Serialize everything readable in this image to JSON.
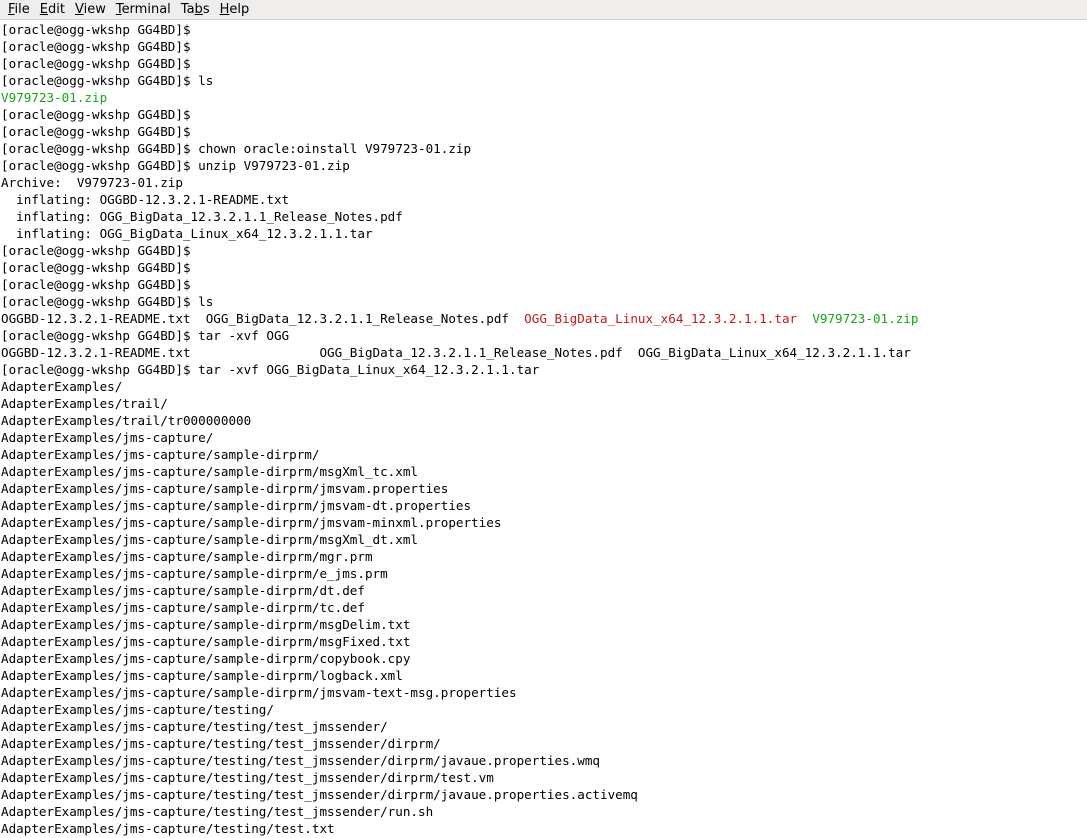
{
  "menubar": {
    "items": [
      {
        "name": "menu-file",
        "pre": "",
        "key": "F",
        "post": "ile"
      },
      {
        "name": "menu-edit",
        "pre": "",
        "key": "E",
        "post": "dit"
      },
      {
        "name": "menu-view",
        "pre": "",
        "key": "V",
        "post": "iew"
      },
      {
        "name": "menu-terminal",
        "pre": "",
        "key": "T",
        "post": "erminal"
      },
      {
        "name": "menu-tabs",
        "pre": "Ta",
        "key": "b",
        "post": "s"
      },
      {
        "name": "menu-help",
        "pre": "",
        "key": "H",
        "post": "elp"
      }
    ]
  },
  "colors": {
    "archive": "#15a515",
    "tarball": "#c01a1a",
    "text": "#000000",
    "background": "#ffffff"
  },
  "terminal": {
    "lines": [
      [
        {
          "t": "[oracle@ogg-wkshp GG4BD]$ "
        }
      ],
      [
        {
          "t": "[oracle@ogg-wkshp GG4BD]$ "
        }
      ],
      [
        {
          "t": "[oracle@ogg-wkshp GG4BD]$ "
        }
      ],
      [
        {
          "t": "[oracle@ogg-wkshp GG4BD]$ ls"
        }
      ],
      [
        {
          "t": "V979723-01.zip",
          "c": "green"
        }
      ],
      [
        {
          "t": "[oracle@ogg-wkshp GG4BD]$ "
        }
      ],
      [
        {
          "t": "[oracle@ogg-wkshp GG4BD]$ "
        }
      ],
      [
        {
          "t": "[oracle@ogg-wkshp GG4BD]$ chown oracle:oinstall V979723-01.zip"
        }
      ],
      [
        {
          "t": "[oracle@ogg-wkshp GG4BD]$ unzip V979723-01.zip"
        }
      ],
      [
        {
          "t": "Archive:  V979723-01.zip"
        }
      ],
      [
        {
          "t": "  inflating: OGGBD-12.3.2.1-README.txt"
        }
      ],
      [
        {
          "t": "  inflating: OGG_BigData_12.3.2.1.1_Release_Notes.pdf"
        }
      ],
      [
        {
          "t": "  inflating: OGG_BigData_Linux_x64_12.3.2.1.1.tar"
        }
      ],
      [
        {
          "t": "[oracle@ogg-wkshp GG4BD]$ "
        }
      ],
      [
        {
          "t": "[oracle@ogg-wkshp GG4BD]$ "
        }
      ],
      [
        {
          "t": "[oracle@ogg-wkshp GG4BD]$ "
        }
      ],
      [
        {
          "t": "[oracle@ogg-wkshp GG4BD]$ ls"
        }
      ],
      [
        {
          "t": "OGGBD-12.3.2.1-README.txt  OGG_BigData_12.3.2.1.1_Release_Notes.pdf  "
        },
        {
          "t": "OGG_BigData_Linux_x64_12.3.2.1.1.tar",
          "c": "red"
        },
        {
          "t": "  "
        },
        {
          "t": "V979723-01.zip",
          "c": "green"
        }
      ],
      [
        {
          "t": "[oracle@ogg-wkshp GG4BD]$ tar -xvf OGG"
        }
      ],
      [
        {
          "t": "OGGBD-12.3.2.1-README.txt                 OGG_BigData_12.3.2.1.1_Release_Notes.pdf  OGG_BigData_Linux_x64_12.3.2.1.1.tar"
        }
      ],
      [
        {
          "t": "[oracle@ogg-wkshp GG4BD]$ tar -xvf OGG_BigData_Linux_x64_12.3.2.1.1.tar"
        }
      ],
      [
        {
          "t": "AdapterExamples/"
        }
      ],
      [
        {
          "t": "AdapterExamples/trail/"
        }
      ],
      [
        {
          "t": "AdapterExamples/trail/tr000000000"
        }
      ],
      [
        {
          "t": "AdapterExamples/jms-capture/"
        }
      ],
      [
        {
          "t": "AdapterExamples/jms-capture/sample-dirprm/"
        }
      ],
      [
        {
          "t": "AdapterExamples/jms-capture/sample-dirprm/msgXml_tc.xml"
        }
      ],
      [
        {
          "t": "AdapterExamples/jms-capture/sample-dirprm/jmsvam.properties"
        }
      ],
      [
        {
          "t": "AdapterExamples/jms-capture/sample-dirprm/jmsvam-dt.properties"
        }
      ],
      [
        {
          "t": "AdapterExamples/jms-capture/sample-dirprm/jmsvam-minxml.properties"
        }
      ],
      [
        {
          "t": "AdapterExamples/jms-capture/sample-dirprm/msgXml_dt.xml"
        }
      ],
      [
        {
          "t": "AdapterExamples/jms-capture/sample-dirprm/mgr.prm"
        }
      ],
      [
        {
          "t": "AdapterExamples/jms-capture/sample-dirprm/e_jms.prm"
        }
      ],
      [
        {
          "t": "AdapterExamples/jms-capture/sample-dirprm/dt.def"
        }
      ],
      [
        {
          "t": "AdapterExamples/jms-capture/sample-dirprm/tc.def"
        }
      ],
      [
        {
          "t": "AdapterExamples/jms-capture/sample-dirprm/msgDelim.txt"
        }
      ],
      [
        {
          "t": "AdapterExamples/jms-capture/sample-dirprm/msgFixed.txt"
        }
      ],
      [
        {
          "t": "AdapterExamples/jms-capture/sample-dirprm/copybook.cpy"
        }
      ],
      [
        {
          "t": "AdapterExamples/jms-capture/sample-dirprm/logback.xml"
        }
      ],
      [
        {
          "t": "AdapterExamples/jms-capture/sample-dirprm/jmsvam-text-msg.properties"
        }
      ],
      [
        {
          "t": "AdapterExamples/jms-capture/testing/"
        }
      ],
      [
        {
          "t": "AdapterExamples/jms-capture/testing/test_jmssender/"
        }
      ],
      [
        {
          "t": "AdapterExamples/jms-capture/testing/test_jmssender/dirprm/"
        }
      ],
      [
        {
          "t": "AdapterExamples/jms-capture/testing/test_jmssender/dirprm/javaue.properties.wmq"
        }
      ],
      [
        {
          "t": "AdapterExamples/jms-capture/testing/test_jmssender/dirprm/test.vm"
        }
      ],
      [
        {
          "t": "AdapterExamples/jms-capture/testing/test_jmssender/dirprm/javaue.properties.activemq"
        }
      ],
      [
        {
          "t": "AdapterExamples/jms-capture/testing/test_jmssender/run.sh"
        }
      ],
      [
        {
          "t": "AdapterExamples/jms-capture/testing/test.txt"
        }
      ]
    ]
  }
}
